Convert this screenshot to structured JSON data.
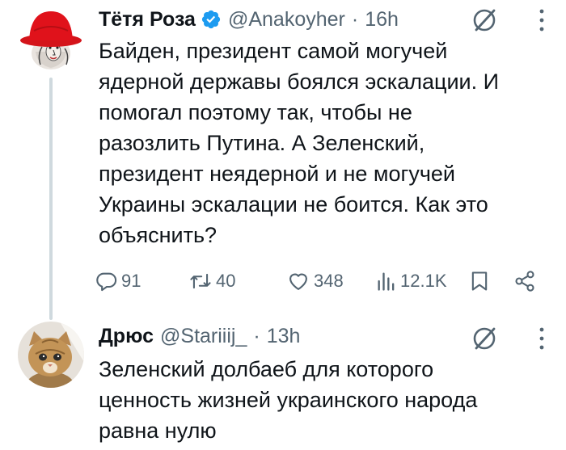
{
  "colors": {
    "text_primary": "#0f1419",
    "text_secondary": "#536471",
    "verified_badge": "#1d9bf0",
    "thread_line": "#cfd9de",
    "background": "#ffffff"
  },
  "thread": [
    {
      "author": {
        "display_name": "Тётя Роза",
        "verified": true,
        "handle": "@Anakoyher",
        "avatar_icon": "red-hat-lady-avatar"
      },
      "time": "16h",
      "separator": "·",
      "text_lines": [
        "Байден, президент самой могучей",
        "ядерной державы боялся эскалации. И",
        "помогал поэтому так, чтобы не",
        "разозлить Путина. А Зеленский,",
        "президент неядерной и не могучей",
        "Украины эскалации не боится. Как это",
        "объяснить?"
      ],
      "stats": {
        "replies": "91",
        "reposts": "40",
        "likes": "348",
        "views": "12.1K"
      }
    },
    {
      "author": {
        "display_name": "Дрюс",
        "verified": false,
        "handle": "@Stariiij_",
        "avatar_icon": "kitten-avatar"
      },
      "time": "13h",
      "separator": "·",
      "text_lines": [
        "Зеленский долбаеб для которого",
        "ценность жизней украинского народа",
        "равна нулю"
      ]
    }
  ]
}
